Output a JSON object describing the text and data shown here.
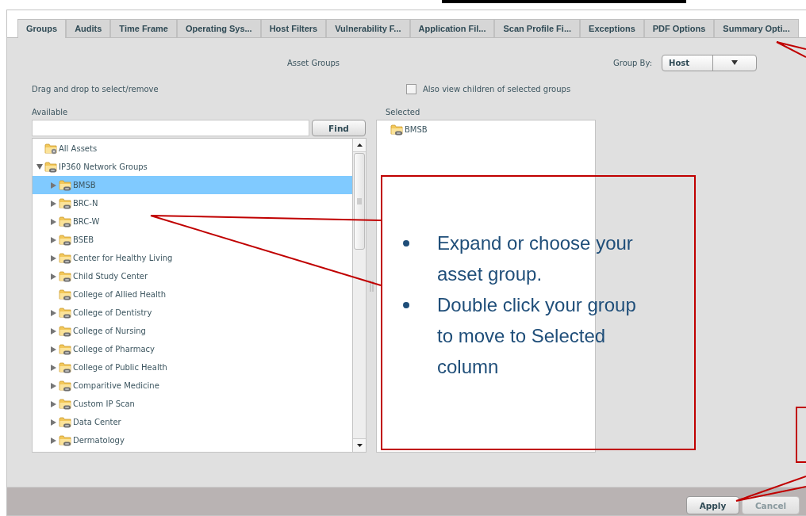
{
  "tabs": [
    {
      "label": "Groups",
      "selected": true
    },
    {
      "label": "Audits",
      "selected": false
    },
    {
      "label": "Time Frame",
      "selected": false
    },
    {
      "label": "Operating Sys...",
      "selected": false
    },
    {
      "label": "Host Filters",
      "selected": false
    },
    {
      "label": "Vulnerability F...",
      "selected": false
    },
    {
      "label": "Application Fil...",
      "selected": false
    },
    {
      "label": "Scan Profile Fi...",
      "selected": false
    },
    {
      "label": "Exceptions",
      "selected": false
    },
    {
      "label": "PDF Options",
      "selected": false
    },
    {
      "label": "Summary Opti...",
      "selected": false
    }
  ],
  "section_title": "Asset Groups",
  "group_by": {
    "label": "Group By:",
    "value": "Host"
  },
  "hint": "Drag and drop to select/remove",
  "children_checkbox": {
    "label": "Also view children of selected groups",
    "checked": false
  },
  "available": {
    "label": "Available",
    "find_button": "Find",
    "tree": [
      {
        "label": "All Assets",
        "kind": "all",
        "expandable": false,
        "selected": false
      },
      {
        "label": "IP360 Network Groups",
        "kind": "group",
        "expandable": true,
        "expanded": true,
        "selected": false,
        "children": [
          {
            "label": "BMSB",
            "kind": "group",
            "expandable": true,
            "expanded": false,
            "selected": true
          },
          {
            "label": "BRC-N",
            "kind": "group",
            "expandable": true,
            "expanded": false,
            "selected": false
          },
          {
            "label": "BRC-W",
            "kind": "group",
            "expandable": true,
            "expanded": false,
            "selected": false
          },
          {
            "label": "BSEB",
            "kind": "group",
            "expandable": true,
            "expanded": false,
            "selected": false
          },
          {
            "label": "Center for Healthy Living",
            "kind": "group",
            "expandable": true,
            "expanded": false,
            "selected": false
          },
          {
            "label": "Child Study Center",
            "kind": "group",
            "expandable": true,
            "expanded": false,
            "selected": false
          },
          {
            "label": "College of Allied Health",
            "kind": "group",
            "expandable": false,
            "selected": false
          },
          {
            "label": "College of Dentistry",
            "kind": "group",
            "expandable": true,
            "expanded": false,
            "selected": false
          },
          {
            "label": "College of Nursing",
            "kind": "group",
            "expandable": true,
            "expanded": false,
            "selected": false
          },
          {
            "label": "College of Pharmacy",
            "kind": "group",
            "expandable": true,
            "expanded": false,
            "selected": false
          },
          {
            "label": "College of Public Health",
            "kind": "group",
            "expandable": true,
            "expanded": false,
            "selected": false
          },
          {
            "label": "Comparitive Medicine",
            "kind": "group",
            "expandable": true,
            "expanded": false,
            "selected": false
          },
          {
            "label": "Custom IP Scan",
            "kind": "group",
            "expandable": true,
            "expanded": false,
            "selected": false
          },
          {
            "label": "Data Center",
            "kind": "group",
            "expandable": true,
            "expanded": false,
            "selected": false
          },
          {
            "label": "Dermatology",
            "kind": "group",
            "expandable": true,
            "expanded": false,
            "selected": false
          }
        ]
      }
    ]
  },
  "selected_panel": {
    "label": "Selected",
    "items": [
      {
        "label": "BMSB",
        "kind": "group"
      }
    ]
  },
  "callout": {
    "bullets": [
      "Expand or choose your asset group.",
      "Double click your group to move to Selected column"
    ]
  },
  "buttons": [
    {
      "label": "Apply",
      "disabled": false
    },
    {
      "label": "Cancel",
      "disabled": true
    }
  ]
}
